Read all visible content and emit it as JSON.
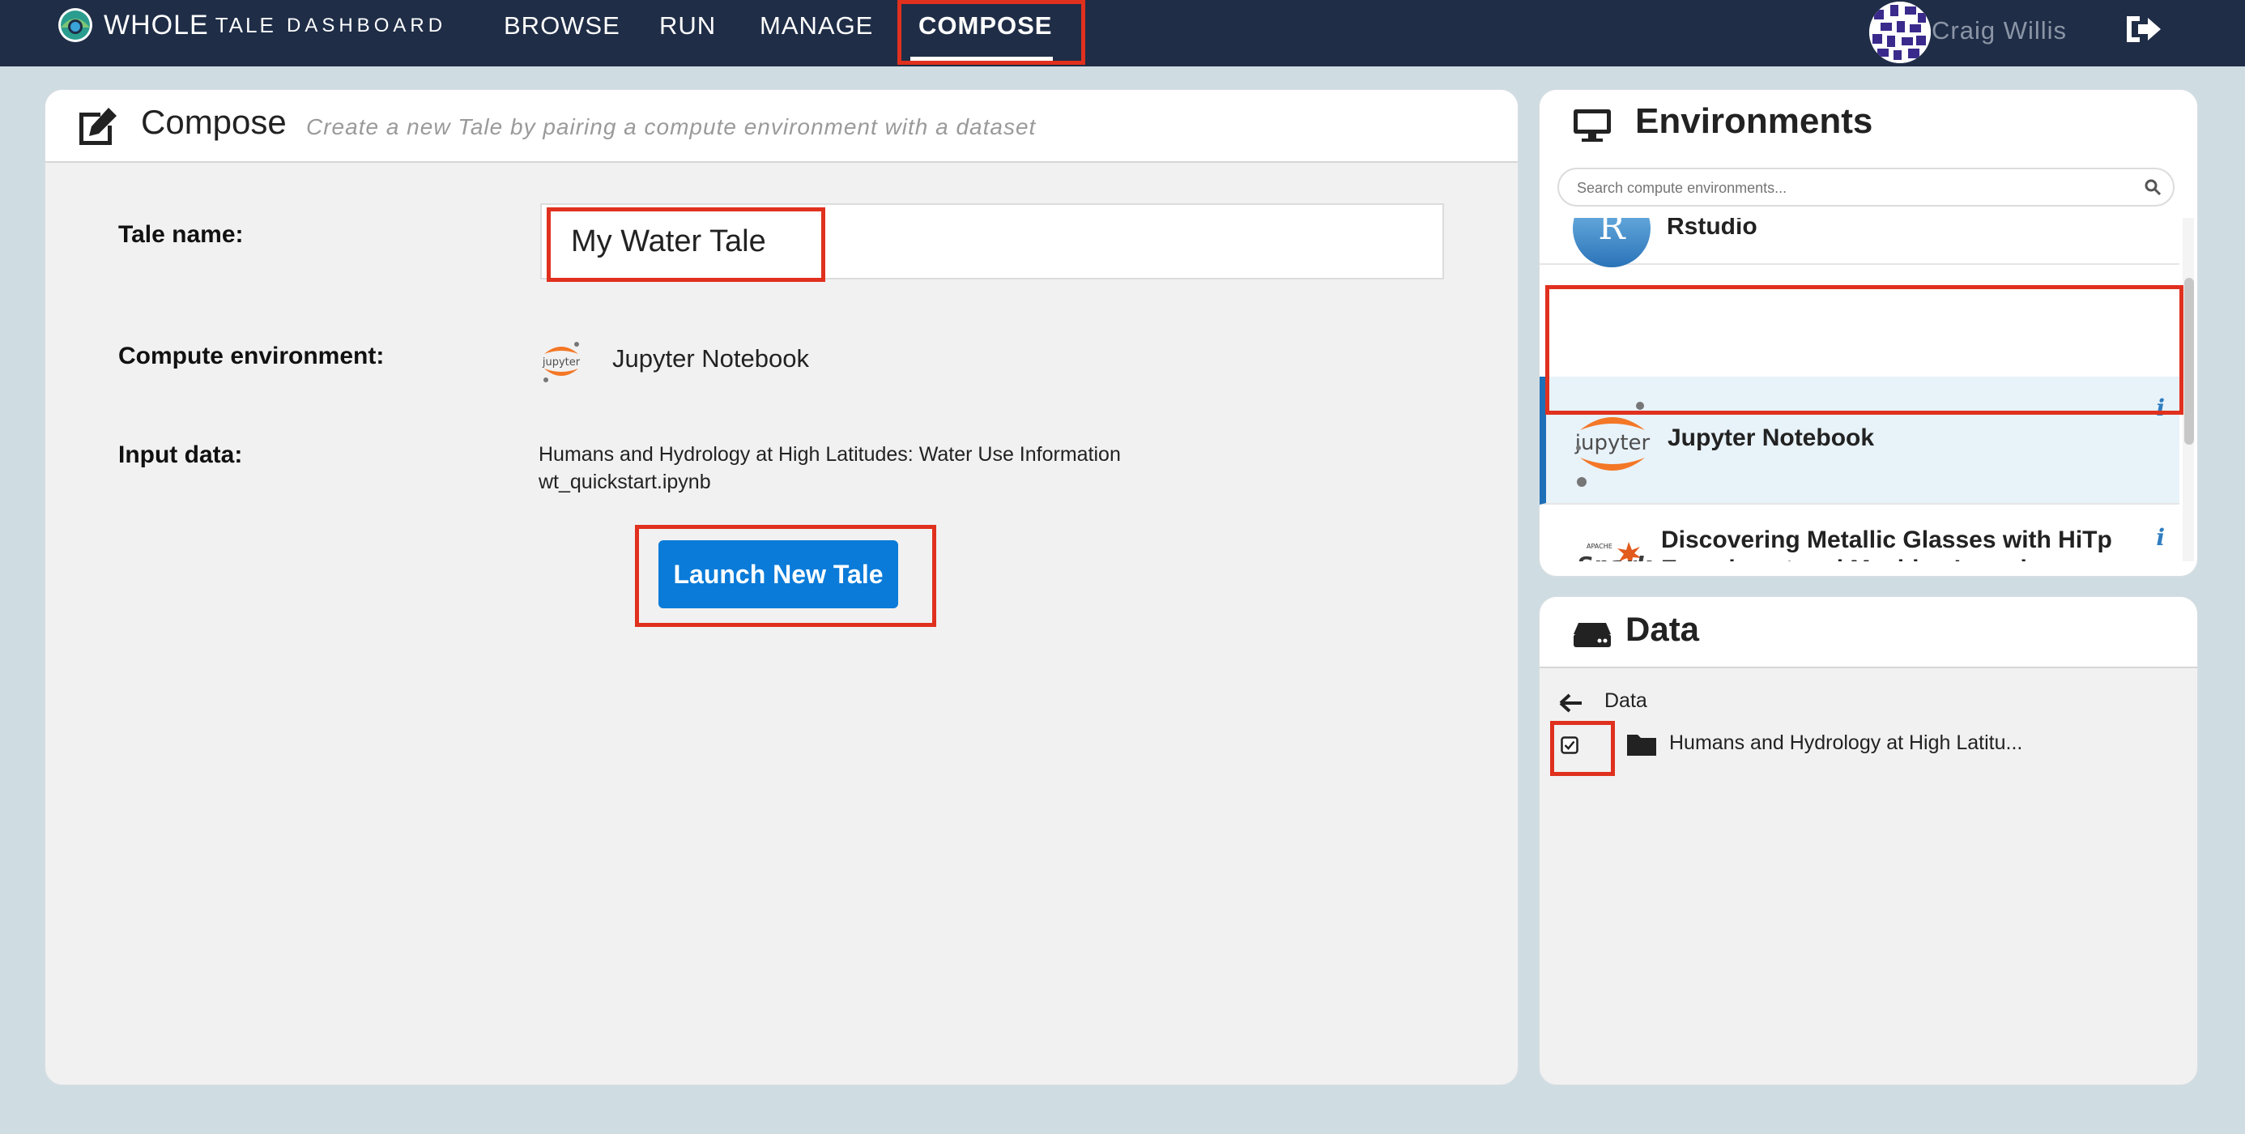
{
  "nav": {
    "brand_whole": "WHOLE",
    "brand_tale": "TALE",
    "brand_dashboard": "DASHBOARD",
    "items": [
      "BROWSE",
      "RUN",
      "MANAGE",
      "COMPOSE"
    ],
    "active": "COMPOSE",
    "user_name": "Craig Willis",
    "logout_icon": "sign-out-icon"
  },
  "compose": {
    "title": "Compose",
    "subtitle": "Create a new Tale by pairing a compute environment with a dataset",
    "tale_name_label": "Tale name:",
    "tale_name_value": "My Water Tale",
    "compute_env_label": "Compute environment:",
    "compute_env_value": "Jupyter Notebook",
    "input_data_label": "Input data:",
    "input_data_lines": [
      "Humans and Hydrology at High Latitudes: Water Use Information",
      "wt_quickstart.ipynb"
    ],
    "launch_button": "Launch New Tale"
  },
  "environments": {
    "title": "Environments",
    "search_placeholder": "Search compute environments...",
    "items": [
      {
        "name": "Rstudio",
        "icon": "rstudio-logo"
      },
      {
        "name": "Jupyter Notebook",
        "icon": "jupyter-logo",
        "selected": true
      },
      {
        "name": "Discovering Metallic Glasses with HiTp Experiment and Machine Learning",
        "icon": "spark-logo"
      }
    ],
    "info_glyph": "i"
  },
  "data": {
    "title": "Data",
    "breadcrumb": "Data",
    "items": [
      {
        "name": "Humans and Hydrology at High Latitu...",
        "checked": true,
        "icon": "folder-icon"
      }
    ]
  },
  "colors": {
    "nav_bg": "#1f2d47",
    "page_bg": "#cfdde3",
    "primary_button": "#0a7bd9",
    "selected_row": "#e8f2f9",
    "highlight_box": "#e0301e"
  }
}
